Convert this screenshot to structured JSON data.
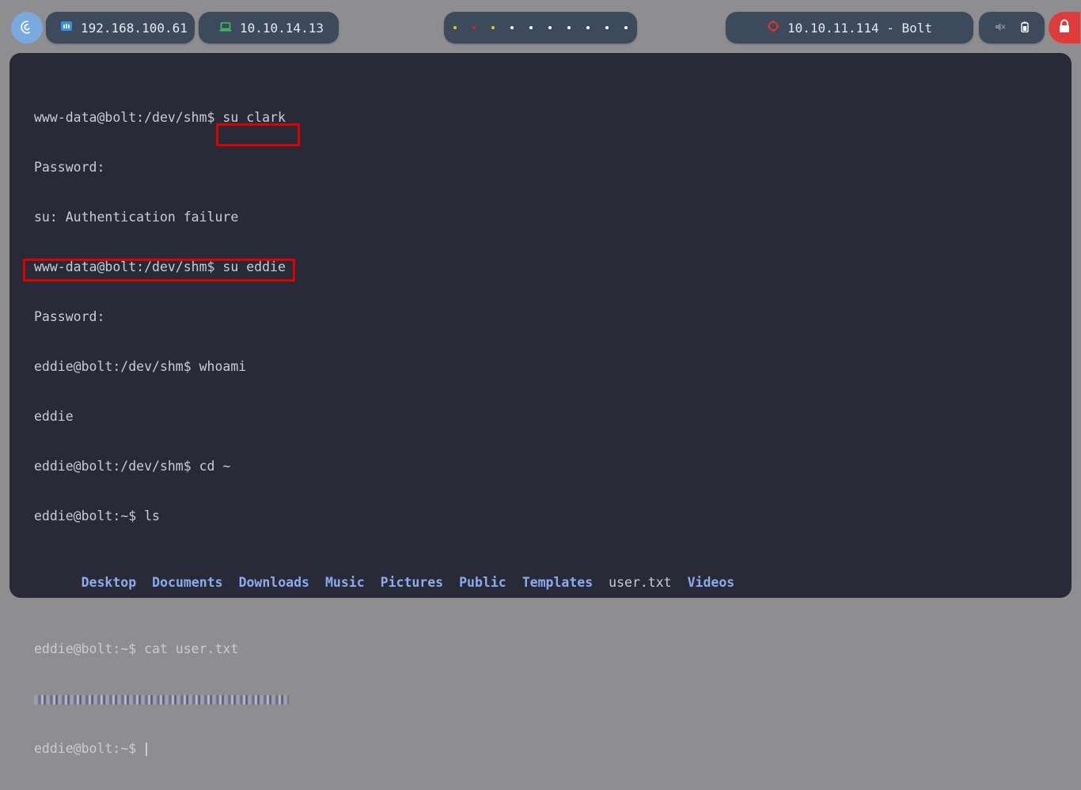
{
  "topbar": {
    "ip_local": "192.168.100.61",
    "ip_vpn": "10.10.14.13",
    "target": "10.10.11.114 - Bolt",
    "workspace_dot_colors": [
      "#f5c211",
      "#e01b24",
      "#f5c211",
      "#ffffff",
      "#ffffff",
      "#ffffff",
      "#ffffff",
      "#ffffff",
      "#ffffff",
      "#ffffff"
    ]
  },
  "terminal": {
    "lines": [
      "www-data@bolt:/dev/shm$ su clark",
      "Password:",
      "su: Authentication failure",
      "www-data@bolt:/dev/shm$ su eddie",
      "Password:",
      "eddie@bolt:/dev/shm$ whoami",
      "eddie",
      "eddie@bolt:/dev/shm$ cd ~",
      "eddie@bolt:~$ ls"
    ],
    "ls_output": [
      {
        "name": "Desktop",
        "kind": "dir"
      },
      {
        "name": "Documents",
        "kind": "dir"
      },
      {
        "name": "Downloads",
        "kind": "dir"
      },
      {
        "name": "Music",
        "kind": "dir"
      },
      {
        "name": "Pictures",
        "kind": "dir"
      },
      {
        "name": "Public",
        "kind": "dir"
      },
      {
        "name": "Templates",
        "kind": "dir"
      },
      {
        "name": "user.txt",
        "kind": "file"
      },
      {
        "name": "Videos",
        "kind": "dir"
      }
    ],
    "cat_line": "eddie@bolt:~$ cat user.txt",
    "final_prompt": "eddie@bolt:~$ "
  },
  "colors": {
    "highlight": "#e00000",
    "dir": "#8caaee",
    "text": "#c9ccd6",
    "terminal_bg": "#292a37"
  }
}
